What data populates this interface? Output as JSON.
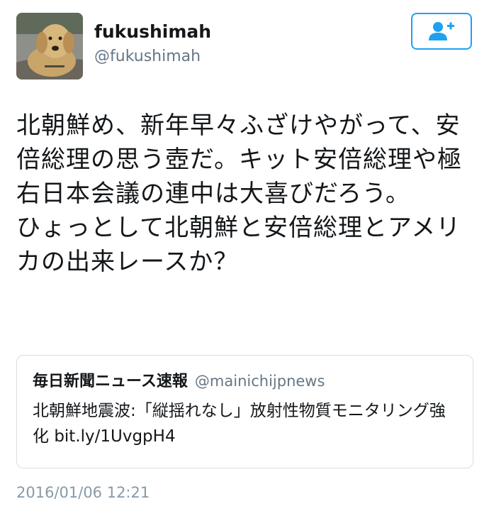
{
  "author": {
    "display_name": "fukushimah",
    "handle": "@fukushimah",
    "avatar_icon": "dog-avatar"
  },
  "follow_button": {
    "icon": "add-user-icon",
    "accent_color": "#1da1f2"
  },
  "tweet": {
    "paragraph_1": "北朝鮮め、新年早々ふざけやがって、安倍総理の思う壺だ。キット安倍総理や極右日本会議の連中は大喜びだろう。",
    "paragraph_2": "ひょっとして北朝鮮と安倍総理とアメリカの出来レースか？"
  },
  "quoted_tweet": {
    "display_name": "毎日新聞ニュース速報",
    "handle": "@mainichijpnews",
    "text": "北朝鮮地震波:「縦揺れなし」放射性物質モニタリング強化 ",
    "link": "bit.ly/1UvgpH4"
  },
  "timestamp": "2016/01/06 12:21"
}
